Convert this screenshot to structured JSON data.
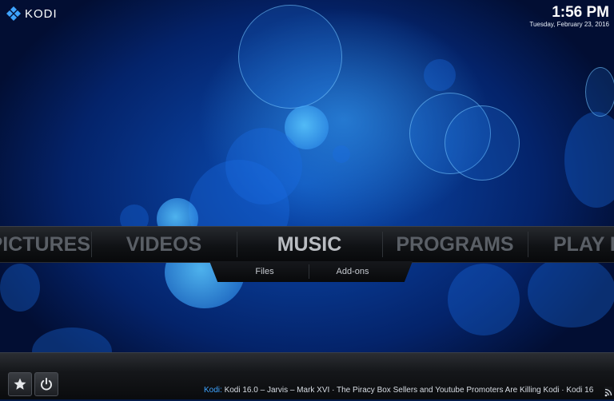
{
  "app": {
    "name": "KODI"
  },
  "clock": {
    "time": "1:56 PM",
    "date": "Tuesday, February 23, 2016"
  },
  "main_menu": {
    "items": [
      {
        "label": "PICTURES"
      },
      {
        "label": "VIDEOS"
      },
      {
        "label": "MUSIC"
      },
      {
        "label": "PROGRAMS"
      },
      {
        "label": "PLAY DISC"
      }
    ],
    "selected": "MUSIC"
  },
  "submenu": {
    "items": [
      {
        "label": "Files"
      },
      {
        "label": "Add-ons"
      }
    ]
  },
  "bottom": {
    "favourites_icon": "star-icon",
    "power_icon": "power-icon",
    "ticker_source": "Kodi:",
    "ticker_text": "Kodi 16.0 – Jarvis – Mark XVI · The Piracy Box Sellers and Youtube Promoters Are Killing Kodi · Kodi 16"
  },
  "colors": {
    "accent": "#3ea3ff",
    "menu_active": "#b9bcc1",
    "menu_inactive": "#5a5f66"
  }
}
